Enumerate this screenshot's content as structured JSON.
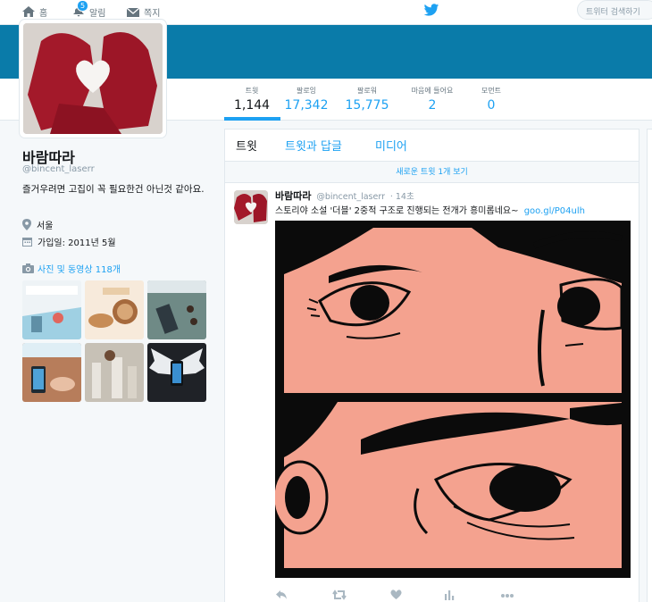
{
  "nav": {
    "home_label": "홈",
    "notifications_label": "알림",
    "notifications_count": "5",
    "messages_label": "쪽지",
    "search_placeholder": "트위터 검색하기"
  },
  "profile_nav": {
    "stats": [
      {
        "label": "트윗",
        "value": "1,144"
      },
      {
        "label": "팔로잉",
        "value": "17,342"
      },
      {
        "label": "팔로워",
        "value": "15,775"
      },
      {
        "label": "마음에 들어요",
        "value": "2"
      },
      {
        "label": "모먼트",
        "value": "0"
      }
    ]
  },
  "profile": {
    "name": "바람따라",
    "handle": "@bincent_laserr",
    "bio": "즐거우려면 고집이 꼭 필요한건 아닌것 같아요.",
    "location": "서울",
    "joined": "가입일: 2011년 5월",
    "photos_label": "사진 및 동영상 118개"
  },
  "timeline": {
    "tabs": [
      "트윗",
      "트윗과 답글",
      "미디어"
    ],
    "new_tweets": "새로운 트윗 1개 보기",
    "tweet": {
      "name": "바람따라",
      "handle": "@bincent_laserr",
      "time": "· 14초",
      "text": "스토리야 소설 '더블' 2중적 구조로 진행되는 전개가 흥미롭네요~",
      "link": "goo.gl/P04ulh"
    }
  },
  "colors": {
    "accent": "#1da1f2",
    "banner": "#0a7ba9",
    "comic_skin": "#f4a28f"
  }
}
